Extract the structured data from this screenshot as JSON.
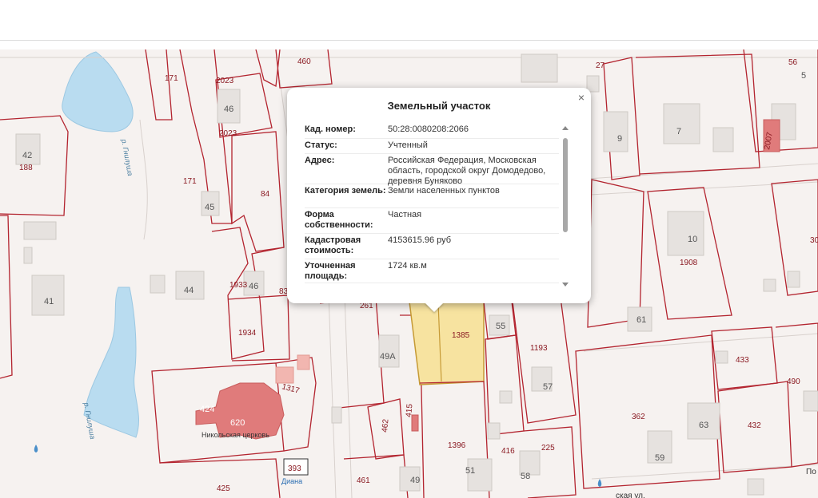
{
  "popup": {
    "title": "Земельный участок",
    "close_symbol": "×",
    "rows": [
      {
        "label": "Кад. номер:",
        "value": "50:28:0080208:2066"
      },
      {
        "label": "Статус:",
        "value": "Учтенный"
      },
      {
        "label": "Адрес:",
        "value": "Российская Федерация, Московская область, городской округ Домодедово, деревня Буняково"
      },
      {
        "label": "Категория земель:",
        "value": "Земли населенных пунктов"
      },
      {
        "label": "Форма собственности:",
        "value": "Частная"
      },
      {
        "label": "Кадастровая стоимость:",
        "value": "4153615.96 руб"
      },
      {
        "label": "Уточненная площадь:",
        "value": "1724 кв.м"
      }
    ]
  },
  "map": {
    "parcel_labels": [
      "460",
      "171",
      "2023",
      "2023",
      "27",
      "56",
      "5",
      "188",
      "171",
      "84",
      "2007",
      "1908",
      "1933",
      "1934",
      "261",
      "1193",
      "1385",
      "1317",
      "424",
      "462",
      "415",
      "1396",
      "416",
      "225",
      "362",
      "433",
      "490",
      "432",
      "393",
      "425",
      "461",
      "83",
      "30"
    ],
    "building_numbers": [
      "46",
      "42",
      "45",
      "44",
      "41",
      "46",
      "49А",
      "55",
      "57",
      "51",
      "49",
      "58",
      "59",
      "61",
      "63",
      "10",
      "7",
      "9",
      "620"
    ],
    "river_labels": [
      "р. Гнилуша",
      "р. Гнилуша"
    ],
    "place_labels": [
      "Никольская церковь",
      "Диана"
    ],
    "street_labels": [
      "По",
      "ская ул."
    ],
    "colors": {
      "parcel_line": "#b3242f",
      "selected_parcel": "#f7e3a0",
      "building": "#e6e2df",
      "church": "#e07b7b",
      "water": "#b9dcf0"
    }
  }
}
